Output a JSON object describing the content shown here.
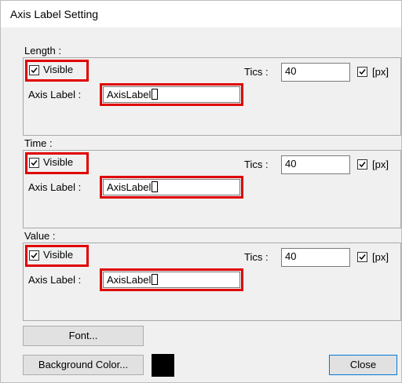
{
  "dialog": {
    "title": "Axis Label Setting",
    "close_label": "Close"
  },
  "sections": [
    {
      "label": "Length :",
      "visible_label": "Visible",
      "visible_checked": true,
      "axis_label_caption": "Axis Label :",
      "axis_label_value": "AxisLabel",
      "tics_label": "Tics :",
      "tics_value": "40",
      "px_label": "[px]",
      "px_checked": true
    },
    {
      "label": "Time :",
      "visible_label": "Visible",
      "visible_checked": true,
      "axis_label_caption": "Axis Label :",
      "axis_label_value": "AxisLabel",
      "tics_label": "Tics :",
      "tics_value": "40",
      "px_label": "[px]",
      "px_checked": true
    },
    {
      "label": "Value :",
      "visible_label": "Visible",
      "visible_checked": true,
      "axis_label_caption": "Axis Label :",
      "axis_label_value": "AxisLabel",
      "tics_label": "Tics :",
      "tics_value": "40",
      "px_label": "[px]",
      "px_checked": true
    }
  ],
  "buttons": {
    "font_label": "Font...",
    "background_color_label": "Background Color..."
  },
  "colors": {
    "background_swatch": "#000000",
    "highlight": "#e00000"
  }
}
